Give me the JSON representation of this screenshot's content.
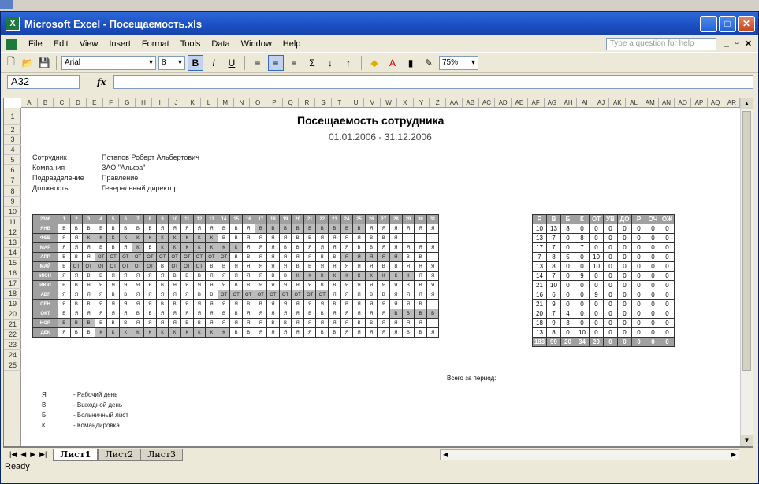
{
  "window": {
    "title": "Microsoft Excel - Посещаемость.xls"
  },
  "menu": {
    "items": [
      "File",
      "Edit",
      "View",
      "Insert",
      "Format",
      "Tools",
      "Data",
      "Window",
      "Help"
    ],
    "help_placeholder": "Type a question for help"
  },
  "toolbar": {
    "font": "Arial",
    "size": "8",
    "bold": "B",
    "italic": "I",
    "underline": "U",
    "sigma": "Σ",
    "zoom": "75%"
  },
  "formula": {
    "cell": "A32",
    "fx": "fx"
  },
  "column_headers": [
    "A",
    "B",
    "C",
    "D",
    "E",
    "F",
    "G",
    "H",
    "I",
    "J",
    "K",
    "L",
    "M",
    "N",
    "O",
    "P",
    "Q",
    "R",
    "S",
    "T",
    "U",
    "V",
    "W",
    "X",
    "Y",
    "Z",
    "AA",
    "AB",
    "AC",
    "AD",
    "AE",
    "AF",
    "AG",
    "AH",
    "AI",
    "AJ",
    "AK",
    "AL",
    "AM",
    "AN",
    "AO",
    "AP",
    "AQ",
    "AR"
  ],
  "row_numbers": [
    "1",
    "2",
    "3",
    "4",
    "5",
    "6",
    "7",
    "8",
    "9",
    "10",
    "11",
    "12",
    "13",
    "14",
    "15",
    "16",
    "17",
    "18",
    "19",
    "20",
    "21",
    "22",
    "23",
    "24",
    "25"
  ],
  "report": {
    "title": "Посещаемость сотрудника",
    "period": "01.01.2006 - 31.12.2006",
    "fields": [
      {
        "label": "Сотрудник",
        "value": "Потапов Роберт Альбертович"
      },
      {
        "label": "Компания",
        "value": "ЗАО \"Альфа\""
      },
      {
        "label": "Подразделение",
        "value": "Правление"
      },
      {
        "label": "Должность",
        "value": "Генеральный директор"
      }
    ],
    "year": "2006",
    "days": [
      "1",
      "2",
      "3",
      "4",
      "5",
      "6",
      "7",
      "8",
      "9",
      "10",
      "11",
      "12",
      "13",
      "14",
      "15",
      "16",
      "17",
      "18",
      "19",
      "20",
      "21",
      "22",
      "23",
      "24",
      "25",
      "26",
      "27",
      "28",
      "29",
      "30",
      "31"
    ],
    "months": [
      {
        "name": "ЯНВ",
        "days": [
          "В",
          "В",
          "В",
          "В",
          "В",
          "В",
          "В",
          "В",
          "Я",
          "Я",
          "Я",
          "Я",
          "Я",
          "В",
          "В",
          "Я",
          "В",
          "В",
          "В",
          "В",
          "В",
          "В",
          "В",
          "В",
          "В",
          "Я",
          "Я",
          "Я",
          "Я",
          "Я",
          "Я"
        ],
        "grey": [
          16,
          17,
          18,
          19,
          20,
          21,
          22,
          23,
          24
        ]
      },
      {
        "name": "ФЕВ",
        "days": [
          "Я",
          "Я",
          "К",
          "К",
          "К",
          "К",
          "К",
          "К",
          "К",
          "К",
          "К",
          "К",
          "К",
          "В",
          "В",
          "Я",
          "Я",
          "Я",
          "Я",
          "В",
          "В",
          "Я",
          "Я",
          "Я",
          "Я",
          "В",
          "В",
          "Я",
          "",
          "",
          ""
        ],
        "grey": [
          2,
          3,
          4,
          5,
          6,
          7,
          8,
          9,
          10,
          11,
          12
        ]
      },
      {
        "name": "МАР",
        "days": [
          "Я",
          "Я",
          "Я",
          "В",
          "В",
          "Я",
          "К",
          "В",
          "К",
          "К",
          "К",
          "К",
          "К",
          "К",
          "К",
          "Я",
          "Я",
          "Я",
          "В",
          "В",
          "Я",
          "Я",
          "Я",
          "Я",
          "В",
          "В",
          "Я",
          "Я",
          "Я",
          "Я",
          "Я"
        ],
        "grey": [
          6,
          8,
          9,
          10,
          11,
          12,
          13,
          14
        ]
      },
      {
        "name": "АПР",
        "days": [
          "В",
          "В",
          "Я",
          "ОТ",
          "ОТ",
          "ОТ",
          "ОТ",
          "ОТ",
          "ОТ",
          "ОТ",
          "ОТ",
          "ОТ",
          "ОТ",
          "ОТ",
          "В",
          "В",
          "Я",
          "Я",
          "Я",
          "Я",
          "Я",
          "В",
          "В",
          "Я",
          "Я",
          "Я",
          "Я",
          "Я",
          "В",
          "В",
          ""
        ],
        "grey": [
          3,
          4,
          5,
          6,
          7,
          8,
          9,
          10,
          11,
          12,
          13,
          23,
          24,
          25,
          26,
          27
        ]
      },
      {
        "name": "МАЙ",
        "days": [
          "В",
          "ОТ",
          "ОТ",
          "ОТ",
          "ОТ",
          "ОТ",
          "ОТ",
          "ОТ",
          "В",
          "ОТ",
          "ОТ",
          "ОТ",
          "В",
          "В",
          "Я",
          "Я",
          "Я",
          "Я",
          "Я",
          "В",
          "В",
          "Я",
          "Я",
          "Я",
          "Я",
          "Я",
          "В",
          "В",
          "Я",
          "Я",
          "Я"
        ],
        "grey": [
          1,
          2,
          3,
          4,
          5,
          6,
          7,
          9,
          10,
          11
        ]
      },
      {
        "name": "ИЮН",
        "days": [
          "Я",
          "Я",
          "В",
          "В",
          "Я",
          "Я",
          "Я",
          "Я",
          "Я",
          "В",
          "В",
          "В",
          "Я",
          "Я",
          "Я",
          "Я",
          "Я",
          "В",
          "В",
          "К",
          "К",
          "К",
          "К",
          "К",
          "К",
          "К",
          "К",
          "К",
          "К",
          "Я",
          "Я"
        ],
        "grey": [
          19,
          20,
          21,
          22,
          23,
          24,
          25,
          26,
          27,
          28
        ]
      },
      {
        "name": "ИЮЛ",
        "days": [
          "В",
          "В",
          "Я",
          "Я",
          "Я",
          "Я",
          "Я",
          "В",
          "В",
          "Я",
          "Я",
          "Я",
          "Я",
          "Я",
          "В",
          "В",
          "Я",
          "Я",
          "Я",
          "Я",
          "Я",
          "В",
          "В",
          "Я",
          "Я",
          "Я",
          "Я",
          "Я",
          "В",
          "В",
          "Я"
        ],
        "grey": []
      },
      {
        "name": "АВГ",
        "days": [
          "Я",
          "Я",
          "Я",
          "Я",
          "В",
          "В",
          "Я",
          "Я",
          "Я",
          "Я",
          "Я",
          "В",
          "В",
          "ОТ",
          "ОТ",
          "ОТ",
          "ОТ",
          "ОТ",
          "ОТ",
          "ОТ",
          "ОТ",
          "ОТ",
          "Я",
          "Я",
          "Я",
          "В",
          "В",
          "Я",
          "Я",
          "Я",
          "Я"
        ],
        "grey": [
          13,
          14,
          15,
          16,
          17,
          18,
          19,
          20,
          21
        ]
      },
      {
        "name": "СЕН",
        "days": [
          "Я",
          "В",
          "В",
          "Я",
          "Я",
          "Я",
          "Я",
          "Я",
          "В",
          "В",
          "Я",
          "Я",
          "Я",
          "Я",
          "Я",
          "В",
          "В",
          "Я",
          "Я",
          "Я",
          "Я",
          "Я",
          "В",
          "В",
          "Я",
          "Я",
          "Я",
          "Я",
          "Я",
          "В",
          ""
        ],
        "grey": []
      },
      {
        "name": "ОКТ",
        "days": [
          "В",
          "Я",
          "Я",
          "Я",
          "Я",
          "Я",
          "В",
          "В",
          "Я",
          "Я",
          "Я",
          "Я",
          "Я",
          "В",
          "В",
          "Я",
          "Я",
          "Я",
          "Я",
          "Я",
          "В",
          "В",
          "Я",
          "Я",
          "Я",
          "Я",
          "Я",
          "В",
          "В",
          "В",
          "В"
        ],
        "grey": [
          27,
          28,
          29,
          30
        ]
      },
      {
        "name": "НОЯ",
        "days": [
          "В",
          "В",
          "В",
          "В",
          "В",
          "В",
          "Я",
          "Я",
          "Я",
          "Я",
          "В",
          "В",
          "Я",
          "Я",
          "Я",
          "Я",
          "Я",
          "В",
          "В",
          "Я",
          "Я",
          "Я",
          "Я",
          "Я",
          "В",
          "В",
          "Я",
          "Я",
          "Я",
          "Я",
          ""
        ],
        "grey": [
          0,
          1,
          2
        ]
      },
      {
        "name": "ДЕК",
        "days": [
          "Я",
          "В",
          "В",
          "К",
          "К",
          "К",
          "К",
          "К",
          "К",
          "К",
          "К",
          "К",
          "К",
          "К",
          "В",
          "В",
          "Я",
          "Я",
          "Я",
          "Я",
          "Я",
          "В",
          "В",
          "Я",
          "Я",
          "Я",
          "Я",
          "Я",
          "В",
          "В",
          "Я"
        ],
        "grey": [
          3,
          4,
          5,
          6,
          7,
          8,
          9,
          10,
          11,
          12,
          13
        ]
      }
    ],
    "summary_headers": [
      "Я",
      "В",
      "Б",
      "К",
      "ОТ",
      "УВ",
      "ДО",
      "Р",
      "ОЧ",
      "ОЖ"
    ],
    "summary_rows": [
      [
        "10",
        "13",
        "8",
        "0",
        "0",
        "0",
        "0",
        "0",
        "0",
        "0"
      ],
      [
        "13",
        "7",
        "0",
        "8",
        "0",
        "0",
        "0",
        "0",
        "0",
        "0"
      ],
      [
        "17",
        "7",
        "0",
        "7",
        "0",
        "0",
        "0",
        "0",
        "0",
        "0"
      ],
      [
        "7",
        "8",
        "5",
        "0",
        "10",
        "0",
        "0",
        "0",
        "0",
        "0"
      ],
      [
        "13",
        "8",
        "0",
        "0",
        "10",
        "0",
        "0",
        "0",
        "0",
        "0"
      ],
      [
        "14",
        "7",
        "0",
        "9",
        "0",
        "0",
        "0",
        "0",
        "0",
        "0"
      ],
      [
        "21",
        "10",
        "0",
        "0",
        "0",
        "0",
        "0",
        "0",
        "0",
        "0"
      ],
      [
        "16",
        "6",
        "0",
        "0",
        "9",
        "0",
        "0",
        "0",
        "0",
        "0"
      ],
      [
        "21",
        "9",
        "0",
        "0",
        "0",
        "0",
        "0",
        "0",
        "0",
        "0"
      ],
      [
        "20",
        "7",
        "4",
        "0",
        "0",
        "0",
        "0",
        "0",
        "0",
        "0"
      ],
      [
        "18",
        "9",
        "3",
        "0",
        "0",
        "0",
        "0",
        "0",
        "0",
        "0"
      ],
      [
        "13",
        "8",
        "0",
        "10",
        "0",
        "0",
        "0",
        "0",
        "0",
        "0"
      ]
    ],
    "total_label": "Всего за период:",
    "total_row": [
      "183",
      "99",
      "20",
      "34",
      "29",
      "0",
      "0",
      "0",
      "0",
      "0"
    ],
    "legend": [
      {
        "code": "Я",
        "text": "- Рабочий день"
      },
      {
        "code": "В",
        "text": "- Выходной день"
      },
      {
        "code": "Б",
        "text": "- Больничный лист"
      },
      {
        "code": "К",
        "text": "- Командировка"
      }
    ]
  },
  "sheets": [
    "Лист1",
    "Лист2",
    "Лист3"
  ],
  "status": "Ready"
}
